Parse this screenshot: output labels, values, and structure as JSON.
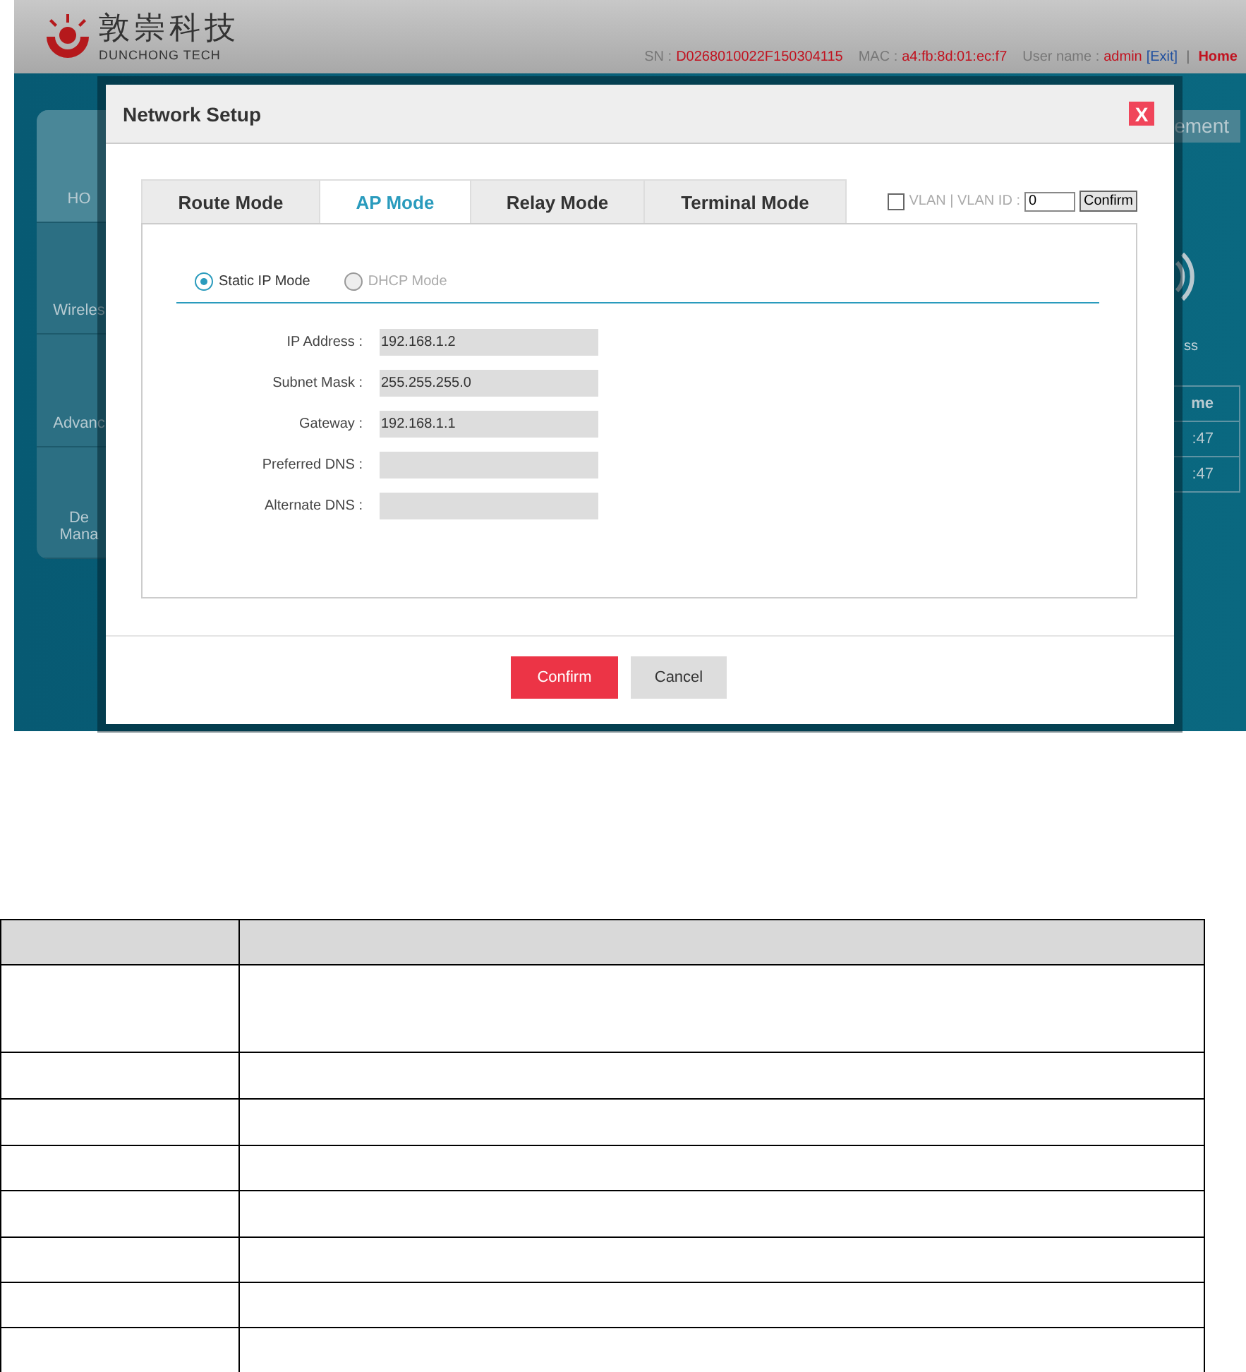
{
  "header": {
    "brand_cn": "敦崇科技",
    "brand_en": "DUNCHONG TECH",
    "sn_label": "SN :",
    "sn": "D0268010022F150304115",
    "mac_label": "MAC :",
    "mac": "a4:fb:8d:01:ec:f7",
    "user_label": "User name :",
    "user": "admin",
    "exit": "[Exit]",
    "separator": "|",
    "home": "Home"
  },
  "background": {
    "sidebar": [
      {
        "lines": [
          "HO"
        ],
        "selected": true
      },
      {
        "lines": [
          "Wireles"
        ],
        "selected": false
      },
      {
        "lines": [
          "Advanc"
        ],
        "selected": false
      },
      {
        "lines": [
          "De",
          "Mana"
        ],
        "selected": false
      }
    ],
    "right_button": "ement",
    "wifi_caption": "ss",
    "table_header": "me",
    "table_rows": [
      ":47",
      ":47"
    ]
  },
  "dialog": {
    "title": "Network Setup",
    "close": "X",
    "tabs": [
      {
        "label": "Route Mode",
        "selected": false
      },
      {
        "label": "AP Mode",
        "selected": true
      },
      {
        "label": "Relay Mode",
        "selected": false
      },
      {
        "label": "Terminal Mode",
        "selected": false
      }
    ],
    "vlan": {
      "checked": false,
      "label": "VLAN | VLAN ID :",
      "value": "0",
      "button": "Confirm"
    },
    "ip_modes": [
      {
        "label": "Static IP Mode",
        "selected": true
      },
      {
        "label": "DHCP Mode",
        "selected": false
      }
    ],
    "fields": [
      {
        "label": "IP Address :",
        "value": "192.168.1.2"
      },
      {
        "label": "Subnet Mask :",
        "value": "255.255.255.0"
      },
      {
        "label": "Gateway :",
        "value": "192.168.1.1"
      },
      {
        "label": "Preferred DNS :"
      },
      {
        "label": "Alternate DNS :"
      }
    ],
    "buttons": [
      {
        "label": "Confirm",
        "kind": "primary"
      },
      {
        "label": "Cancel",
        "kind": "secondary"
      }
    ]
  }
}
